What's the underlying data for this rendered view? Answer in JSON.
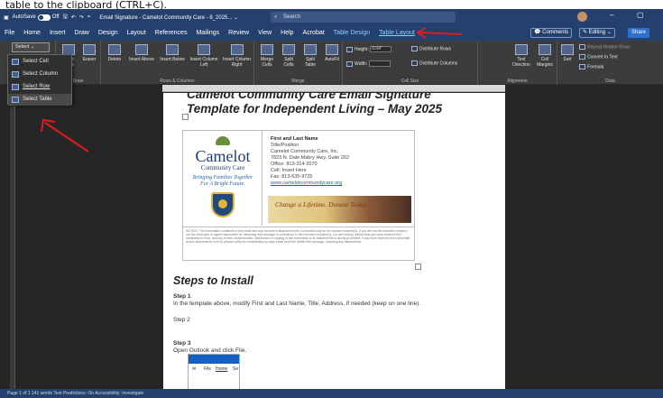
{
  "header_text": "table to the clipboard (CTRL+C).",
  "titlebar": {
    "autosave_label": "AutoSave",
    "autosave_state": "Off",
    "doc_title": "Email Signature - Camelot Community Care - 8_2025... ⌄",
    "search_placeholder": "Search"
  },
  "menu": {
    "tabs": [
      "File",
      "Home",
      "Insert",
      "Draw",
      "Design",
      "Layout",
      "References",
      "Mailings",
      "Review",
      "View",
      "Help",
      "Acrobat"
    ],
    "context_tabs": [
      "Table Design",
      "Table Layout"
    ],
    "comments": "Comments",
    "editing": "Editing ⌄",
    "share": "Share"
  },
  "ribbon": {
    "select": "Select ⌄",
    "draw_table": "Draw Table",
    "eraser": "Eraser",
    "delete": "Delete",
    "insert_above": "Insert Above",
    "insert_below": "Insert Below",
    "insert_left": "Insert Column Left",
    "insert_right": "Insert Column Right",
    "merge_cells": "Merge Cells",
    "split_cells": "Split Cells",
    "split_table": "Split Table",
    "autofit": "AutoFit",
    "height_label": "Height:",
    "height_value": "0.04\"",
    "width_label": "Width:",
    "width_value": "",
    "distribute_rows": "Distribute Rows",
    "distribute_columns": "Distribute Columns",
    "text_direction": "Text Direction",
    "cell_margins": "Cell Margins",
    "sort": "Sort",
    "repeat_header": "Repeat Header Rows",
    "convert_text": "Convert to Text",
    "formula": "Formula",
    "groups": {
      "draw": "Draw",
      "rows": "Rows & Columns",
      "merge": "Merge",
      "cell_size": "Cell Size",
      "alignment": "Alignment",
      "data": "Data"
    }
  },
  "select_menu": [
    "Select Cell",
    "Select Column",
    "Select Row",
    "Select Table"
  ],
  "document": {
    "title_line1": "Camelot Community Care Email Signature",
    "title_line2": "Template for Independent Living – May 2025",
    "logo_name": "Camelot",
    "logo_sub": "Community Care",
    "tagline": "Bringing Families Together For A Bright Future.",
    "contact": {
      "name": "First and Last Name",
      "title": "Title/Position",
      "org": "Camelot Community Care, Inc.",
      "address": "7823 N. Dale Mabry Hwy, Suite 202",
      "office": "Office: 813-314-2070",
      "cell": "Cell: Insert Here",
      "fax": "Fax: 813-635-9725",
      "website": "www.camelotcommunitycare.org"
    },
    "photo_quote": "Change a Lifetime. Donate Today",
    "notice": "NOTICE: The information contained in this email and any document attached hereto is intended only for the named recipient(s). If you are not the intended recipient, nor the employee or agent responsible for delivering this message in confidence to the intended recipient(s), you are hereby notified that you have received this transmittal in error, and any review, dissemination, distribution or copying of this transmittal or its attachments is strictly prohibited. If you have received this transmittal and/or attachments in error, please notify me immediately by reply email and then delete this message, including any attachments.",
    "steps_heading": "Steps to Install",
    "step1_label": "Step 1",
    "step1_text": "In the template above, modify First and Last Name, Title, Address, if needed (keep on one line).",
    "step2_label": "Step 2",
    "step3_label": "Step 3",
    "step3_text": "Open Outlook and click File.",
    "outlook_file": "File",
    "outlook_home": "Home",
    "outlook_se": "Se"
  },
  "status": {
    "text": "Page 1 of 1    141 words    Text Predictions: On    Accessibility: Investigate"
  }
}
